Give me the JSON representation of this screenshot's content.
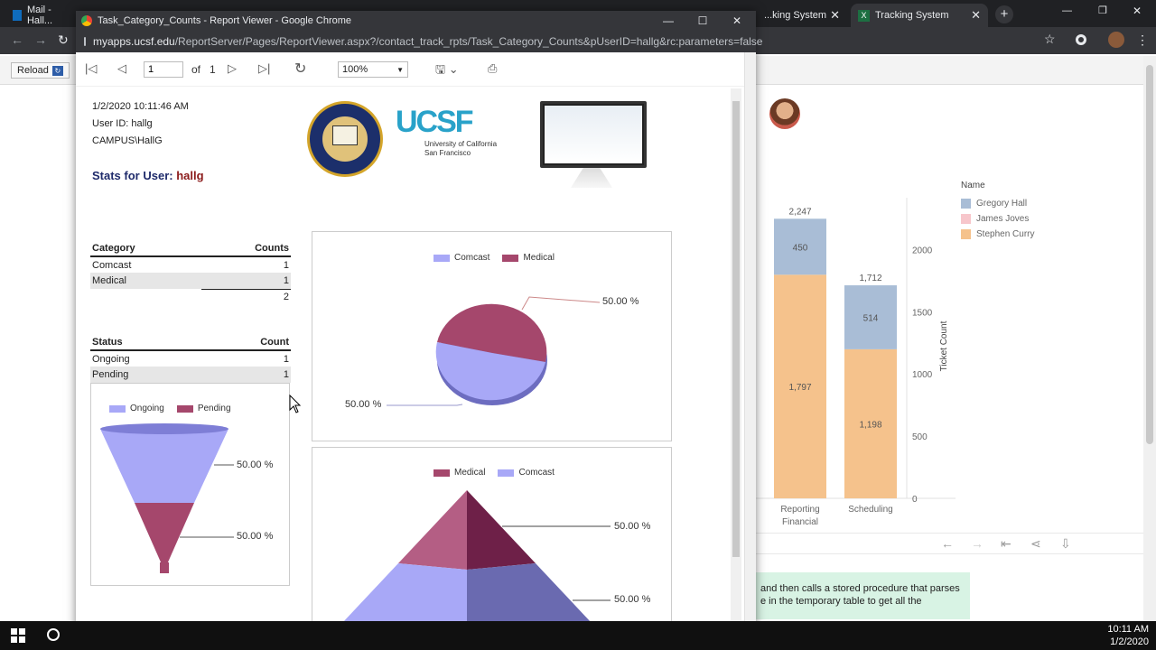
{
  "bg_browser": {
    "tabs": [
      {
        "label": "Mail - Hall..."
      },
      {
        "label": "...king System"
      },
      {
        "label": "Tracking System"
      }
    ],
    "reload_label": "Reload"
  },
  "tableau": {
    "legend_title": "Name",
    "legend": [
      {
        "name": "Gregory Hall",
        "color": "#a9bdd6"
      },
      {
        "name": "James Joves",
        "color": "#f7c6cb"
      },
      {
        "name": "Stephen Curry",
        "color": "#f5c28c"
      }
    ],
    "y_axis_title": "Ticket Count",
    "y_ticks": [
      "2000",
      "1500",
      "1000",
      "500",
      "0"
    ],
    "chart_data": {
      "type": "bar",
      "categories": [
        "Reporting Financial",
        "Scheduling"
      ],
      "category_lines": [
        [
          "Reporting",
          "Financial"
        ],
        [
          "Scheduling"
        ]
      ],
      "series": [
        {
          "name": "Stephen Curry",
          "values": [
            1797,
            1198
          ],
          "labels": [
            "1,797",
            "1,198"
          ]
        },
        {
          "name": "Gregory Hall",
          "values": [
            450,
            514
          ],
          "labels": [
            "450",
            "514"
          ]
        }
      ],
      "totals": [
        "2,247",
        "1,712"
      ],
      "ylabel": "Ticket Count",
      "ylim": [
        0,
        2300
      ]
    },
    "note_line1": "and then calls a stored procedure that parses",
    "note_line2": "e in the temporary table to get all the"
  },
  "popup": {
    "window_title": "Task_Category_Counts - Report Viewer - Google Chrome",
    "url_host": "myapps.ucsf.edu",
    "url_path": "/ReportServer/Pages/ReportViewer.aspx?/contact_track_rpts/Task_Category_Counts&pUserID=hallg&rc:parameters=false"
  },
  "report_viewer": {
    "page_value": "1",
    "of_label": "of",
    "total_pages": "1",
    "zoom": "100%"
  },
  "report": {
    "timestamp": "1/2/2020 10:11:46 AM",
    "user_id": "User ID: hallg",
    "domain_user": "CAMPUS\\HallG",
    "stats_label": "Stats for User:",
    "stats_user": "hallg",
    "ucsf_logo_text": "UCSF",
    "ucsf_line1": "University of California",
    "ucsf_line2": "San Francisco",
    "category_table": {
      "headers": [
        "Category",
        "Counts"
      ],
      "rows": [
        [
          "Comcast",
          "1"
        ],
        [
          "Medical",
          "1"
        ]
      ],
      "total": "2"
    },
    "status_table": {
      "headers": [
        "Status",
        "Count"
      ],
      "rows": [
        [
          "Ongoing",
          "1"
        ],
        [
          "Pending",
          "1"
        ]
      ]
    },
    "pie_chart": {
      "legend": [
        {
          "name": "Comcast",
          "color": "#a8a8f7"
        },
        {
          "name": "Medical",
          "color": "#a5476c"
        }
      ],
      "labels": [
        "50.00 %",
        "50.00 %"
      ],
      "chart_data": {
        "type": "pie",
        "categories": [
          "Comcast",
          "Medical"
        ],
        "values": [
          50,
          50
        ]
      }
    },
    "funnel_chart": {
      "legend": [
        {
          "name": "Ongoing",
          "color": "#a8a8f7"
        },
        {
          "name": "Pending",
          "color": "#a5476c"
        }
      ],
      "labels": [
        "50.00 %",
        "50.00 %"
      ]
    },
    "pyramid_chart": {
      "legend": [
        {
          "name": "Medical",
          "color": "#a5476c"
        },
        {
          "name": "Comcast",
          "color": "#a8a8f7"
        }
      ],
      "labels": [
        "50.00 %",
        "50.00 %"
      ]
    }
  },
  "taskbar": {
    "time": "10:11 AM",
    "date": "1/2/2020"
  }
}
